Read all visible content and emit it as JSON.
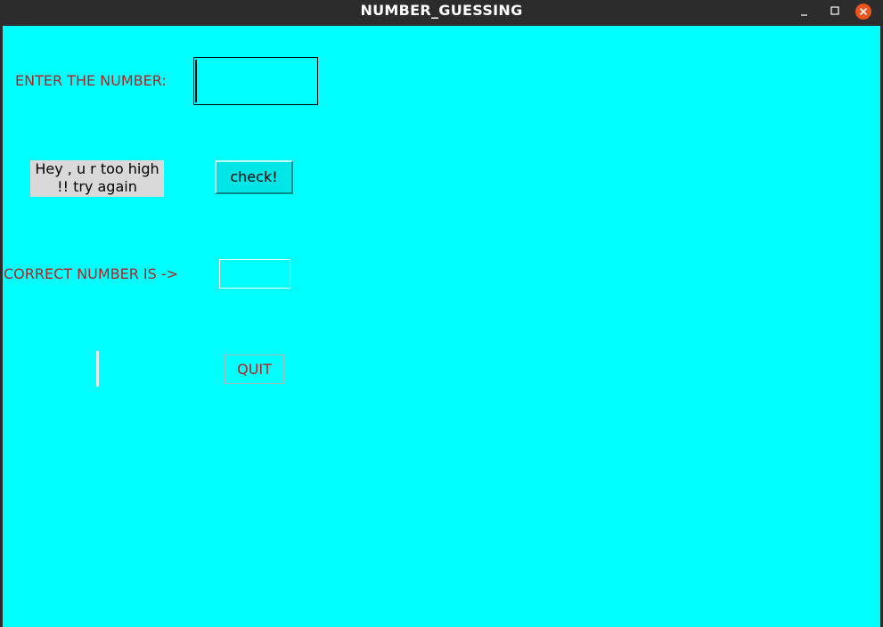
{
  "window": {
    "title": "NUMBER_GUESSING",
    "minimize_symbol": "–",
    "maximize_symbol": "□",
    "close_symbol": "✕"
  },
  "form": {
    "enter_label": "ENTER THE NUMBER:",
    "enter_value": "",
    "message_line1": "Hey , u r too high",
    "message_line2": "!! try again",
    "check_label": "check!",
    "correct_label": "CORRECT NUMBER IS ->",
    "correct_value": "",
    "quit_label": "QUIT"
  },
  "colors": {
    "background": "#00ffff",
    "label_text": "#b22222",
    "message_bg": "#d9d9d9",
    "titlebar": "#2c2c2c",
    "close_button": "#e9541f"
  },
  "icons": {
    "minimize": "minimize-icon",
    "maximize": "maximize-icon",
    "close": "close-icon"
  }
}
